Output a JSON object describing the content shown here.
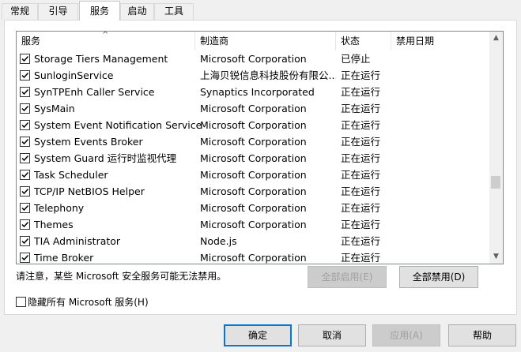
{
  "tabs": [
    {
      "label": "常规"
    },
    {
      "label": "引导"
    },
    {
      "label": "服务"
    },
    {
      "label": "启动"
    },
    {
      "label": "工具"
    }
  ],
  "active_tab": "服务",
  "columns": {
    "name": "服务",
    "manufacturer": "制造商",
    "status": "状态",
    "disabled_date": "禁用日期"
  },
  "services": [
    {
      "name": "Storage Tiers Management",
      "manufacturer": "Microsoft Corporation",
      "status": "已停止",
      "checked": true
    },
    {
      "name": "SunloginService",
      "manufacturer": "上海贝锐信息科技股份有限公...",
      "status": "正在运行",
      "checked": true
    },
    {
      "name": "SynTPEnh Caller Service",
      "manufacturer": "Synaptics Incorporated",
      "status": "正在运行",
      "checked": true
    },
    {
      "name": "SysMain",
      "manufacturer": "Microsoft Corporation",
      "status": "正在运行",
      "checked": true
    },
    {
      "name": "System Event Notification Service",
      "manufacturer": "Microsoft Corporation",
      "status": "正在运行",
      "checked": true
    },
    {
      "name": "System Events Broker",
      "manufacturer": "Microsoft Corporation",
      "status": "正在运行",
      "checked": true
    },
    {
      "name": "System Guard 运行时监视代理",
      "manufacturer": "Microsoft Corporation",
      "status": "正在运行",
      "checked": true
    },
    {
      "name": "Task Scheduler",
      "manufacturer": "Microsoft Corporation",
      "status": "正在运行",
      "checked": true
    },
    {
      "name": "TCP/IP NetBIOS Helper",
      "manufacturer": "Microsoft Corporation",
      "status": "正在运行",
      "checked": true
    },
    {
      "name": "Telephony",
      "manufacturer": "Microsoft Corporation",
      "status": "正在运行",
      "checked": true
    },
    {
      "name": "Themes",
      "manufacturer": "Microsoft Corporation",
      "status": "正在运行",
      "checked": true
    },
    {
      "name": "TIA Administrator",
      "manufacturer": "Node.js",
      "status": "正在运行",
      "checked": true
    },
    {
      "name": "Time Broker",
      "manufacturer": "Microsoft Corporation",
      "status": "正在运行",
      "checked": true
    }
  ],
  "scrollbar_position": 0.68,
  "note": "请注意，某些 Microsoft 安全服务可能无法禁用。",
  "enable_all_label": "全部启用(E)",
  "disable_all_label": "全部禁用(D)",
  "hide_ms_label": "隐藏所有 Microsoft 服务(H)",
  "hide_ms_checked": false,
  "footer": {
    "ok": "确定",
    "cancel": "取消",
    "apply": "应用(A)",
    "help": "帮助"
  }
}
